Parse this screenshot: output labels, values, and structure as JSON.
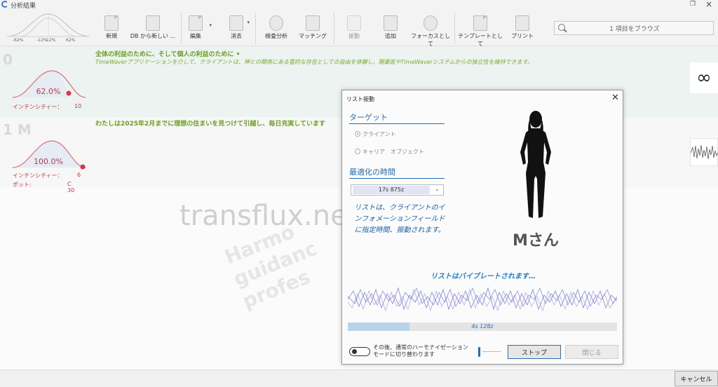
{
  "window": {
    "title": "分析結果"
  },
  "toolbar": {
    "bell_labels": [
      "-62%",
      "-12%",
      "12%",
      "62%"
    ],
    "items": [
      {
        "label": "新規",
        "dim": false
      },
      {
        "label": "DB から新しい ...",
        "dim": false
      },
      {
        "label": "編集",
        "dim": false
      },
      {
        "label": "消去",
        "dim": false
      },
      {
        "label": "検査分析",
        "dim": false
      },
      {
        "label": "マッチング",
        "dim": false
      },
      {
        "label": "振動",
        "dim": true
      },
      {
        "label": "追加",
        "dim": false
      },
      {
        "label": "フォーカスとして",
        "dim": false
      },
      {
        "label": "テンプレートとして",
        "dim": false
      },
      {
        "label": "プリント",
        "dim": false
      }
    ]
  },
  "search": {
    "placeholder": "1 項目をブラウズ"
  },
  "results": [
    {
      "index": "0",
      "percent": "62.0%",
      "percent_value": 62.0,
      "intensity_label": "インテンシティー：",
      "intensity": "10",
      "line1": "全体の利益のために、そして個人の利益のために •",
      "line2": "TimeWaverアプリケーションを介して、クライアントは、神との関係にある霊的な存在としての自由を体験し、開業医やTimeWaverシステムからの独立性を維持できます。",
      "thumb": "infinity-icon"
    },
    {
      "index": "1 M",
      "percent": "100.0%",
      "percent_value": 100.0,
      "intensity_label": "インテンシティー：",
      "intensity": "6",
      "pot_label": "ポット:",
      "pot": "C 30",
      "line1": "わたしは2025年2月までに理想の住まいを見つけて引越し、毎日充実しています",
      "thumb": "wave-thumbnail"
    }
  ],
  "watermark": {
    "text": "transflux.net",
    "rotated": [
      "Harmo",
      "guidanc",
      "profes"
    ]
  },
  "dialog": {
    "title": "リスト振動",
    "target_header": "ターゲット",
    "radio_client": "クライアント",
    "radio_career": "キャリア　オブジェクト",
    "time_header": "最適化の時間",
    "time_value": "17s 875z",
    "description": "リストは、クライアントのインフォメーションフィールドに指定時間、振動されます。",
    "client_name": "Mさん",
    "vibrating_msg": "リストはバイブレートされます…",
    "progress_text": "4s 128z",
    "progress_fraction": 0.23,
    "toggle_label": "その後、通常のハーモナイゼーションモードに切り替わります",
    "stop_label": "ストップ",
    "close_label": "閉じる"
  },
  "footer": {
    "cancel_label": "キャンセル"
  }
}
